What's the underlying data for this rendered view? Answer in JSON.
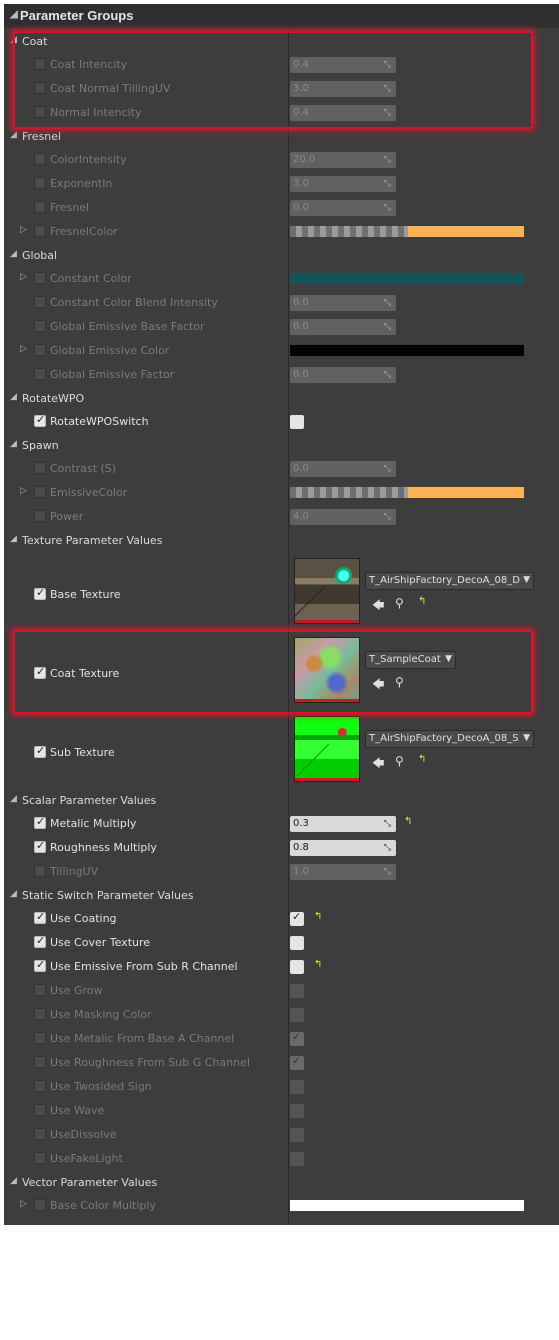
{
  "header": {
    "title": "Parameter Groups"
  },
  "coat": {
    "label": "Coat",
    "intencity": {
      "label": "Coat Intencity",
      "value": "0.4"
    },
    "normal_tilling": {
      "label": "Coat Normal TillingUV",
      "value": "3.0"
    },
    "normal_intencity": {
      "label": "Normal Intencity",
      "value": "0.4"
    }
  },
  "fresnel": {
    "label": "Fresnel",
    "color_intensity": {
      "label": "ColorIntensity",
      "value": "20.0"
    },
    "exponent_in": {
      "label": "ExponentIn",
      "value": "3.0"
    },
    "fresnel": {
      "label": "Fresnel",
      "value": "0.0"
    },
    "fresnel_color": {
      "label": "FresnelColor",
      "color": "#fbb255"
    }
  },
  "global": {
    "label": "Global",
    "constant_color": {
      "label": "Constant Color",
      "color": "#155459"
    },
    "blend_intensity": {
      "label": "Constant Color Blend Intensity",
      "value": "0.0"
    },
    "emissive_base_factor": {
      "label": "Global Emissive Base Factor",
      "value": "0.0"
    },
    "emissive_color": {
      "label": "Global Emissive Color",
      "color": "#000000"
    },
    "emissive_factor": {
      "label": "Global Emissive Factor",
      "value": "0.0"
    }
  },
  "rotatewpo": {
    "label": "RotateWPO",
    "switch": {
      "label": "RotateWPOSwitch"
    }
  },
  "spawn": {
    "label": "Spawn",
    "contrast": {
      "label": "Contrast (S)",
      "value": "0.0"
    },
    "emissive_color": {
      "label": "EmissiveColor",
      "color": "#fbb255"
    },
    "power": {
      "label": "Power",
      "value": "4.0"
    }
  },
  "texture": {
    "label": "Texture Parameter Values",
    "base": {
      "label": "Base Texture",
      "asset": "T_AirShipFactory_DecoA_08_D"
    },
    "coat": {
      "label": "Coat Texture",
      "asset": "T_SampleCoat"
    },
    "sub": {
      "label": "Sub Texture",
      "asset": "T_AirShipFactory_DecoA_08_S"
    }
  },
  "scalar": {
    "label": "Scalar Parameter Values",
    "metalic": {
      "label": "Metalic Multiply",
      "value": "0.3"
    },
    "roughness": {
      "label": "Roughness Multiply",
      "value": "0.8"
    },
    "tilling": {
      "label": "TillingUV",
      "value": "1.0"
    }
  },
  "static_switch": {
    "label": "Static Switch Parameter Values",
    "use_coating": "Use Coating",
    "use_cover_texture": "Use Cover Texture",
    "use_emissive_sub_r": "Use Emissive From Sub R Channel",
    "use_grow": "Use Grow",
    "use_masking_color": "Use Masking Color",
    "use_metalic_base_a": "Use Metalic From Base A Channel",
    "use_roughness_sub_g": "Use Roughness From Sub G Channel",
    "use_twosided_sign": "Use Twosided Sign",
    "use_wave": "Use Wave",
    "use_dissolve": "UseDissolve",
    "use_fake_light": "UseFakeLight"
  },
  "vector": {
    "label": "Vector Parameter Values",
    "base_color_multiply": {
      "label": "Base Color Multiply",
      "color": "#ffffff"
    }
  },
  "icons": {
    "collapse": "triangle-down-icon",
    "expand": "triangle-right-icon",
    "spin": "drag-arrows-icon",
    "reset": "reset-arrow-icon",
    "use_selected": "arrow-left-icon",
    "browse": "magnifier-icon"
  }
}
